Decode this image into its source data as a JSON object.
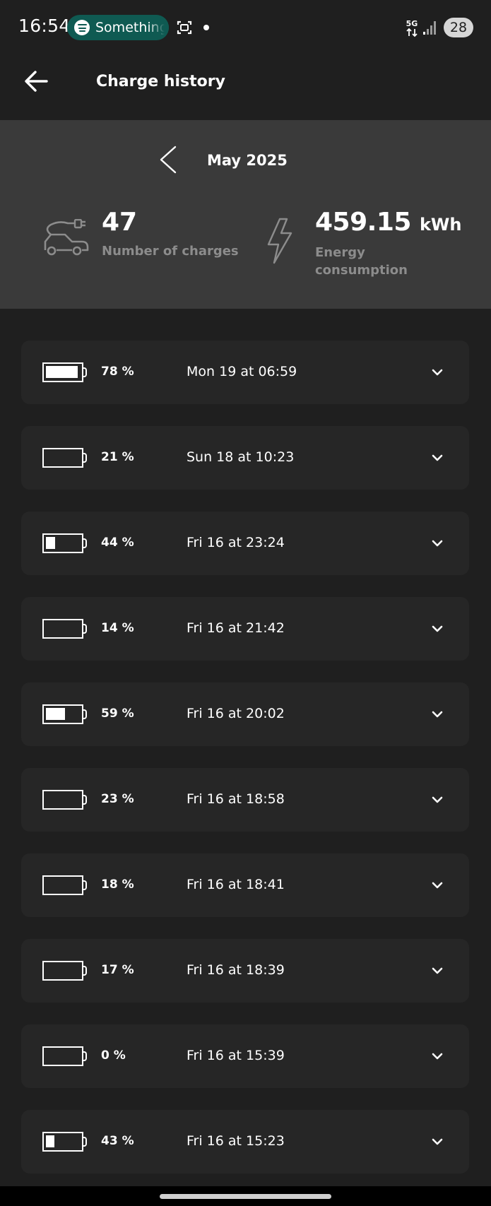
{
  "status_bar": {
    "time": "16:54",
    "spotify_text": "Something",
    "network": "5G",
    "battery": "28"
  },
  "app_bar": {
    "title": "Charge history"
  },
  "summary": {
    "month": "May 2025",
    "charges_count": "47",
    "charges_label": "Number of charges",
    "energy_value": "459.15",
    "energy_unit": "kWh",
    "energy_label": "Energy consumption"
  },
  "charges": [
    {
      "percent": "78 %",
      "level": 78,
      "date": "Mon 19 at 06:59"
    },
    {
      "percent": "21 %",
      "level": 21,
      "date": "Sun 18 at 10:23"
    },
    {
      "percent": "44 %",
      "level": 44,
      "date": "Fri 16 at 23:24"
    },
    {
      "percent": "14 %",
      "level": 14,
      "date": "Fri 16 at 21:42"
    },
    {
      "percent": "59 %",
      "level": 59,
      "date": "Fri 16 at 20:02"
    },
    {
      "percent": "23 %",
      "level": 23,
      "date": "Fri 16 at 18:58"
    },
    {
      "percent": "18 %",
      "level": 18,
      "date": "Fri 16 at 18:41"
    },
    {
      "percent": "17 %",
      "level": 17,
      "date": "Fri 16 at 18:39"
    },
    {
      "percent": "0 %",
      "level": 0,
      "date": "Fri 16 at 15:39"
    },
    {
      "percent": "43 %",
      "level": 43,
      "date": "Fri 16 at 15:23"
    }
  ],
  "icons": {
    "back": "arrow-left-icon",
    "prev_month": "chevron-left-icon",
    "ev": "ev-car-plug-icon",
    "energy": "lightning-bolt-icon",
    "expand": "chevron-down-icon",
    "battery": "battery-icon"
  }
}
